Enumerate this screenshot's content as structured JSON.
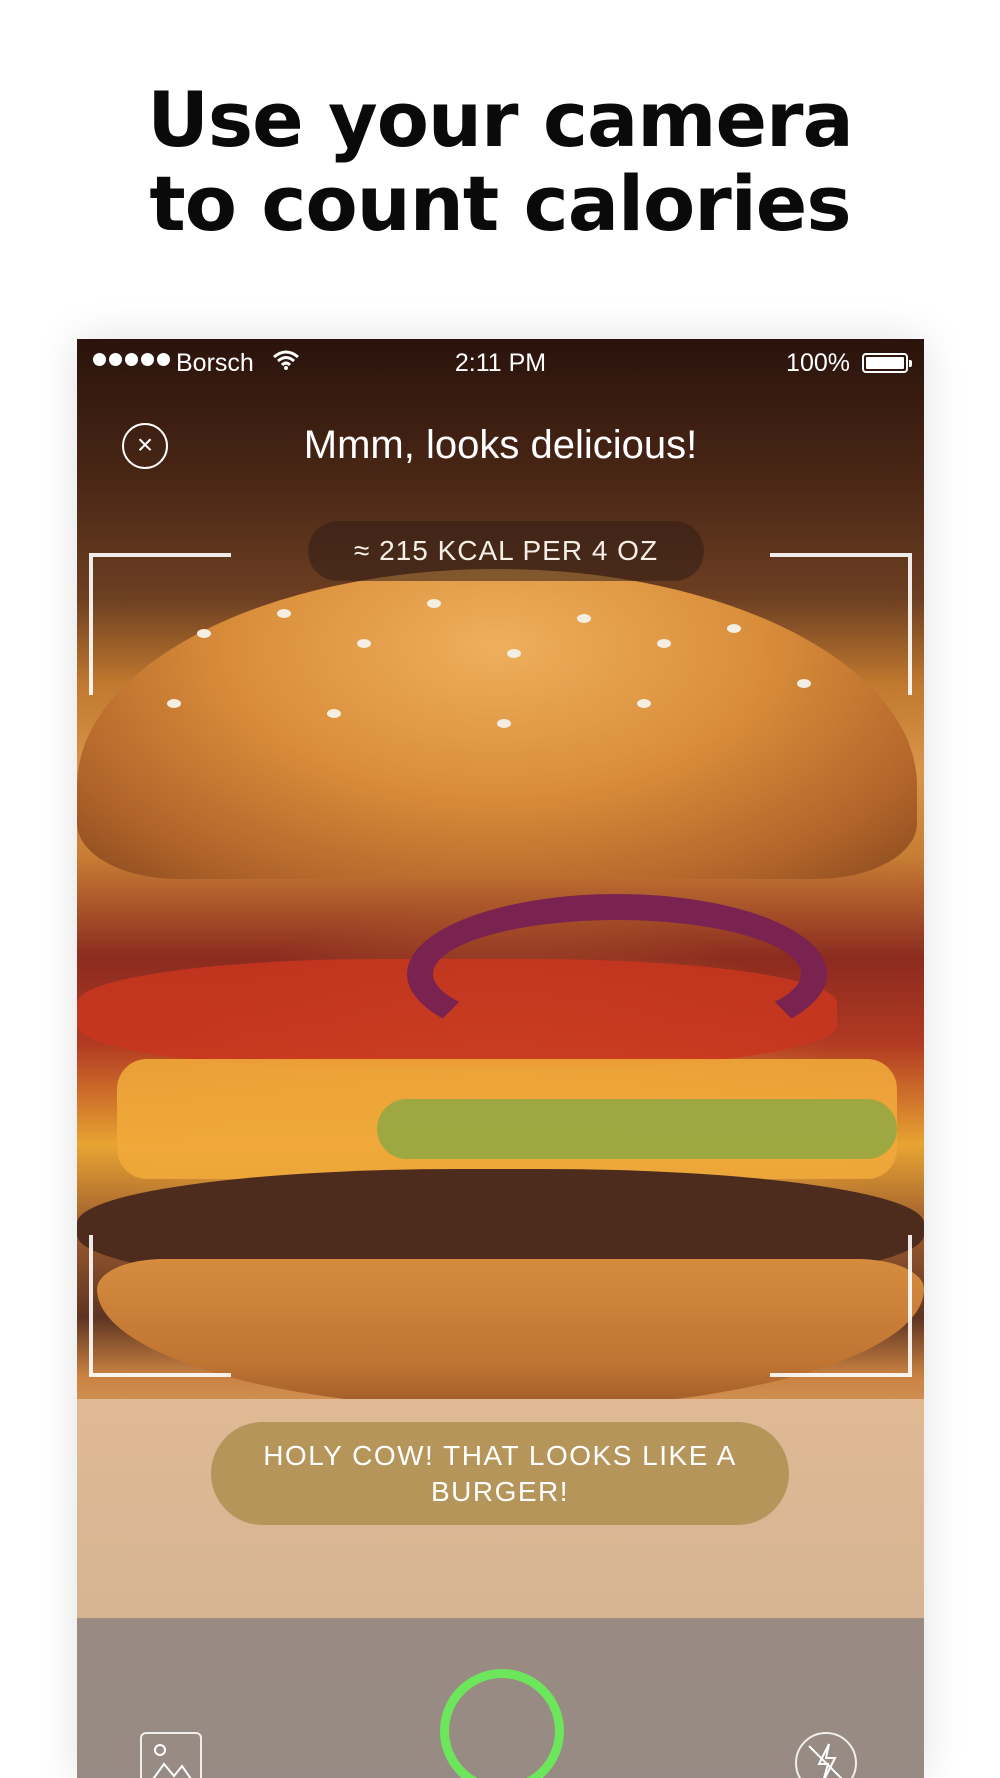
{
  "headline": {
    "line1": "Use your camera",
    "line2": "to count calories"
  },
  "status_bar": {
    "carrier": "Borsch",
    "time": "2:11 PM",
    "battery": "100%"
  },
  "camera": {
    "title": "Mmm, looks delicious!",
    "estimate": "≈ 215 KCAL PER 4 OZ",
    "result": "HOLY COW! THAT LOOKS LIKE A BURGER!"
  },
  "icons": {
    "close": "close-icon",
    "gallery": "gallery-icon",
    "shutter": "shutter-button",
    "flash": "flash-off-icon",
    "wifi": "wifi-icon",
    "battery": "battery-icon"
  },
  "colors": {
    "shutter_ring": "#6ce75c",
    "result_pill": "#b59559"
  }
}
